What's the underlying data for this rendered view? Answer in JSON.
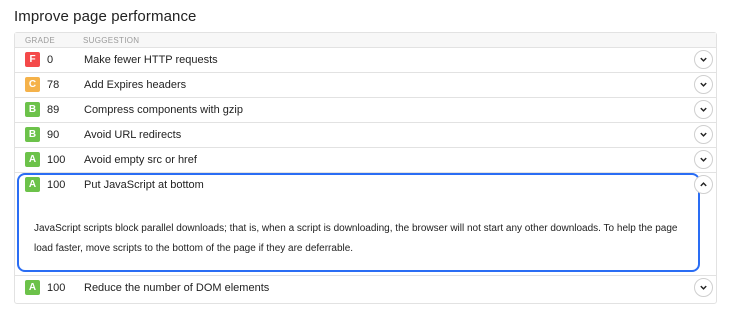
{
  "title": "Improve page performance",
  "columns": {
    "grade": "GRADE",
    "suggestion": "SUGGESTION"
  },
  "colors": {
    "F": "#f44949",
    "C": "#f5b24a",
    "B": "#6cc24a",
    "A": "#6cc24a",
    "highlight": "#2a6df4"
  },
  "rows": [
    {
      "grade": "F",
      "score": "0",
      "label": "Make fewer HTTP requests",
      "toggle_icon": "chevron-down-icon"
    },
    {
      "grade": "C",
      "score": "78",
      "label": "Add Expires headers",
      "toggle_icon": "chevron-down-icon"
    },
    {
      "grade": "B",
      "score": "89",
      "label": "Compress components with gzip",
      "toggle_icon": "chevron-down-icon"
    },
    {
      "grade": "B",
      "score": "90",
      "label": "Avoid URL redirects",
      "toggle_icon": "chevron-down-icon"
    },
    {
      "grade": "A",
      "score": "100",
      "label": "Avoid empty src or href",
      "toggle_icon": "chevron-down-icon"
    }
  ],
  "expanded": {
    "grade": "A",
    "score": "100",
    "label": "Put JavaScript at bottom",
    "toggle_icon": "chevron-up-icon",
    "description": "JavaScript scripts block parallel downloads; that is, when a script is downloading, the browser will not start any other downloads. To help the page load faster, move scripts to the bottom of the page if they are deferrable."
  },
  "last_row": {
    "grade": "A",
    "score": "100",
    "label": "Reduce the number of DOM elements",
    "toggle_icon": "chevron-down-icon"
  }
}
